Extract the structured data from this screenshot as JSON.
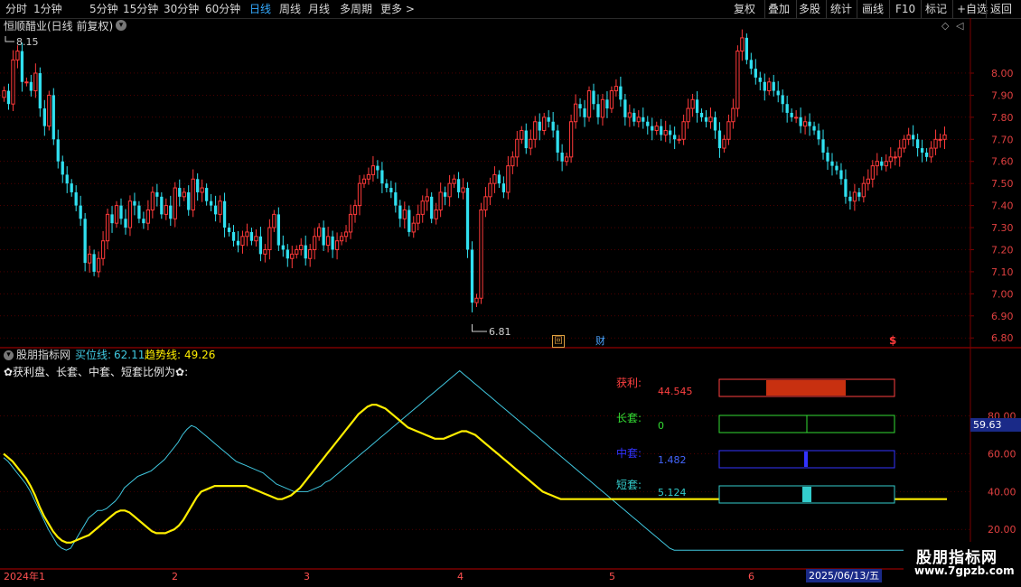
{
  "toolbar": {
    "periods": [
      "分时",
      "1分钟",
      "5分钟",
      "15分钟",
      "30分钟",
      "60分钟",
      "日线",
      "周线",
      "月线",
      "多周期",
      "更多 >"
    ],
    "active_period": "日线",
    "actions": [
      "复权",
      "叠加",
      "多股",
      "统计",
      "画线",
      "F10",
      "标记",
      "+自选",
      "返回"
    ]
  },
  "price_panel": {
    "title": "恒顺醋业(日线 前复权)",
    "high_label": "8.15",
    "low_label": "6.81",
    "badge_label": "回",
    "finance_label": "财",
    "dollar_label": "$",
    "y_ticks": [
      "8.00",
      "7.90",
      "7.80",
      "7.70",
      "7.60",
      "7.50",
      "7.40",
      "7.30",
      "7.20",
      "7.10",
      "7.00",
      "6.90",
      "6.80"
    ]
  },
  "indicator_panel": {
    "name": "股朋指标网",
    "buy_label": "买位线:",
    "buy_value": "62.11",
    "trend_label": "趋势线:",
    "trend_value": "49.26",
    "heading": "✿获利盘、长套、中套、短套比例为✿:",
    "y_ticks": [
      "80.00",
      "60.00",
      "40.00",
      "20.00"
    ],
    "current_value": "59.63",
    "bars": [
      {
        "label": "获利:",
        "value": "44.545",
        "fraction": 0.45,
        "color": "#ff4040"
      },
      {
        "label": "长套:",
        "value": "0",
        "fraction": 0,
        "color": "#33dd33"
      },
      {
        "label": "中套:",
        "value": "1.482",
        "fraction": 0.015,
        "color": "#3333ff"
      },
      {
        "label": "短套:",
        "value": "5.124",
        "fraction": 0.05,
        "color": "#33cccc"
      }
    ]
  },
  "time_axis": {
    "labels": [
      "2024年1",
      "2",
      "3",
      "4",
      "5",
      "6"
    ],
    "cursor_date": "2025/06/13/五"
  },
  "watermark": {
    "name": "股朋指标网",
    "url": "www.7gpzb.com"
  },
  "colors": {
    "up": "#ff3a3a",
    "down": "#30e0f0",
    "grid": "#7a0000",
    "trend_line": "#ffee00",
    "buy_line": "#40c8e0",
    "active": "#33aaff"
  },
  "chart_data": [
    {
      "type": "candlestick",
      "title": "恒顺醋业(日线 前复权)",
      "ylim": [
        6.76,
        8.18
      ],
      "closes": [
        7.92,
        7.86,
        8.06,
        8.1,
        7.96,
        7.96,
        7.92,
        8.0,
        7.84,
        7.76,
        7.9,
        7.7,
        7.6,
        7.54,
        7.5,
        7.46,
        7.4,
        7.34,
        7.14,
        7.18,
        7.1,
        7.16,
        7.24,
        7.36,
        7.32,
        7.4,
        7.34,
        7.3,
        7.42,
        7.4,
        7.34,
        7.32,
        7.38,
        7.46,
        7.44,
        7.36,
        7.4,
        7.34,
        7.48,
        7.44,
        7.46,
        7.38,
        7.52,
        7.46,
        7.48,
        7.42,
        7.4,
        7.36,
        7.42,
        7.3,
        7.28,
        7.24,
        7.22,
        7.26,
        7.28,
        7.24,
        7.26,
        7.18,
        7.2,
        7.3,
        7.36,
        7.22,
        7.2,
        7.16,
        7.18,
        7.2,
        7.22,
        7.16,
        7.2,
        7.26,
        7.3,
        7.22,
        7.26,
        7.2,
        7.24,
        7.26,
        7.28,
        7.36,
        7.4,
        7.5,
        7.52,
        7.54,
        7.58,
        7.56,
        7.5,
        7.48,
        7.46,
        7.4,
        7.34,
        7.38,
        7.28,
        7.32,
        7.36,
        7.42,
        7.44,
        7.34,
        7.38,
        7.46,
        7.44,
        7.5,
        7.52,
        7.46,
        7.48,
        7.2,
        6.96,
        6.98,
        7.38,
        7.44,
        7.5,
        7.54,
        7.5,
        7.46,
        7.58,
        7.62,
        7.7,
        7.74,
        7.66,
        7.7,
        7.78,
        7.74,
        7.8,
        7.78,
        7.74,
        7.64,
        7.6,
        7.62,
        7.78,
        7.86,
        7.84,
        7.8,
        7.92,
        7.86,
        7.8,
        7.88,
        7.84,
        7.92,
        7.94,
        7.88,
        7.8,
        7.82,
        7.78,
        7.8,
        7.78,
        7.76,
        7.74,
        7.76,
        7.72,
        7.74,
        7.72,
        7.7,
        7.7,
        7.78,
        7.84,
        7.88,
        7.82,
        7.8,
        7.78,
        7.8,
        7.74,
        7.66,
        7.7,
        7.78,
        7.84,
        8.1,
        8.16,
        8.06,
        8.02,
        7.98,
        7.96,
        7.92,
        7.96,
        7.92,
        7.9,
        7.86,
        7.82,
        7.8,
        7.8,
        7.76,
        7.78,
        7.76,
        7.74,
        7.7,
        7.64,
        7.6,
        7.58,
        7.56,
        7.52,
        7.44,
        7.42,
        7.46,
        7.44,
        7.5,
        7.52,
        7.58,
        7.6,
        7.58,
        7.6,
        7.62,
        7.62,
        7.66,
        7.7,
        7.72,
        7.7,
        7.66,
        7.64,
        7.62,
        7.66,
        7.7,
        7.7,
        7.72
      ]
    },
    {
      "type": "line",
      "title": "股朋指标网",
      "ylim": [
        0,
        110
      ],
      "series": [
        {
          "name": "买位线",
          "values": [
            58,
            56,
            53,
            50,
            47,
            44,
            40,
            35,
            30,
            25,
            20,
            16,
            12,
            10,
            9,
            10,
            14,
            18,
            22,
            26,
            28,
            30,
            30,
            31,
            33,
            35,
            38,
            42,
            44,
            46,
            48,
            49,
            50,
            51,
            53,
            55,
            57,
            60,
            63,
            66,
            70,
            73,
            75,
            74,
            72,
            70,
            68,
            66,
            64,
            62,
            60,
            58,
            56,
            55,
            54,
            53,
            52,
            51,
            50,
            48,
            46,
            44,
            43,
            42,
            41,
            40,
            40,
            40,
            40,
            41,
            42,
            43,
            45,
            46,
            48,
            50,
            52,
            54,
            56,
            58,
            60,
            62,
            64,
            66,
            68,
            70,
            72,
            74,
            76,
            78,
            80,
            82,
            84,
            86,
            88,
            90,
            92,
            94,
            96,
            98,
            100,
            102,
            104,
            102,
            100,
            98,
            96,
            94,
            92,
            90,
            88,
            86,
            84,
            82,
            80,
            78,
            76,
            74,
            72,
            70,
            68,
            66,
            64,
            62,
            60,
            58,
            56,
            54,
            52,
            50,
            48,
            46,
            44,
            42,
            40,
            38,
            36,
            34,
            32,
            30,
            28,
            26,
            24,
            22,
            20,
            18,
            16,
            14,
            12,
            10,
            9,
            9,
            9,
            9,
            9,
            9,
            9,
            9,
            9,
            9,
            9,
            9,
            9,
            9,
            9,
            9,
            9,
            9,
            9,
            9,
            9,
            9,
            9,
            9,
            9,
            9,
            9,
            9,
            9,
            9,
            9,
            9,
            9,
            9,
            9,
            9,
            9,
            9,
            9,
            9,
            9,
            9,
            9,
            9,
            9,
            9,
            9,
            9,
            9,
            9,
            9,
            9,
            9,
            9,
            9,
            9,
            9,
            9,
            9,
            9,
            9,
            9
          ]
        },
        {
          "name": "趋势线",
          "values": [
            60,
            58,
            56,
            53,
            50,
            47,
            43,
            38,
            32,
            27,
            23,
            19,
            16,
            14,
            13,
            13,
            14,
            15,
            16,
            17,
            19,
            21,
            23,
            25,
            27,
            29,
            30,
            30,
            29,
            27,
            25,
            23,
            21,
            19,
            18,
            18,
            18,
            19,
            20,
            22,
            25,
            29,
            33,
            37,
            40,
            41,
            42,
            43,
            43,
            43,
            43,
            43,
            43,
            43,
            43,
            42,
            41,
            40,
            39,
            38,
            37,
            36,
            36,
            37,
            38,
            40,
            42,
            45,
            48,
            51,
            54,
            57,
            60,
            63,
            66,
            69,
            72,
            75,
            78,
            81,
            83,
            85,
            86,
            86,
            85,
            84,
            82,
            80,
            78,
            76,
            74,
            73,
            72,
            71,
            70,
            69,
            68,
            68,
            68,
            69,
            70,
            71,
            72,
            72,
            71,
            70,
            68,
            66,
            64,
            62,
            60,
            58,
            56,
            54,
            52,
            50,
            48,
            46,
            44,
            42,
            40,
            39,
            38,
            37,
            36,
            36,
            36,
            36,
            36,
            36,
            36,
            36,
            36,
            36,
            36,
            36,
            36,
            36,
            36,
            36,
            36,
            36,
            36,
            36,
            36,
            36,
            36,
            36,
            36,
            36,
            36,
            36,
            36,
            36,
            36,
            36,
            36,
            36,
            36,
            36,
            36,
            36,
            36,
            36,
            36,
            36,
            36,
            36,
            36,
            36,
            36,
            36,
            36,
            36,
            36,
            36,
            36,
            36,
            36,
            36,
            36,
            36,
            36,
            36,
            36,
            36,
            36,
            36,
            36,
            36,
            36,
            36,
            36,
            36,
            36,
            36,
            36,
            36,
            36,
            36,
            36,
            36,
            36,
            36,
            36,
            36,
            36,
            36,
            36,
            36,
            36
          ]
        }
      ]
    }
  ]
}
